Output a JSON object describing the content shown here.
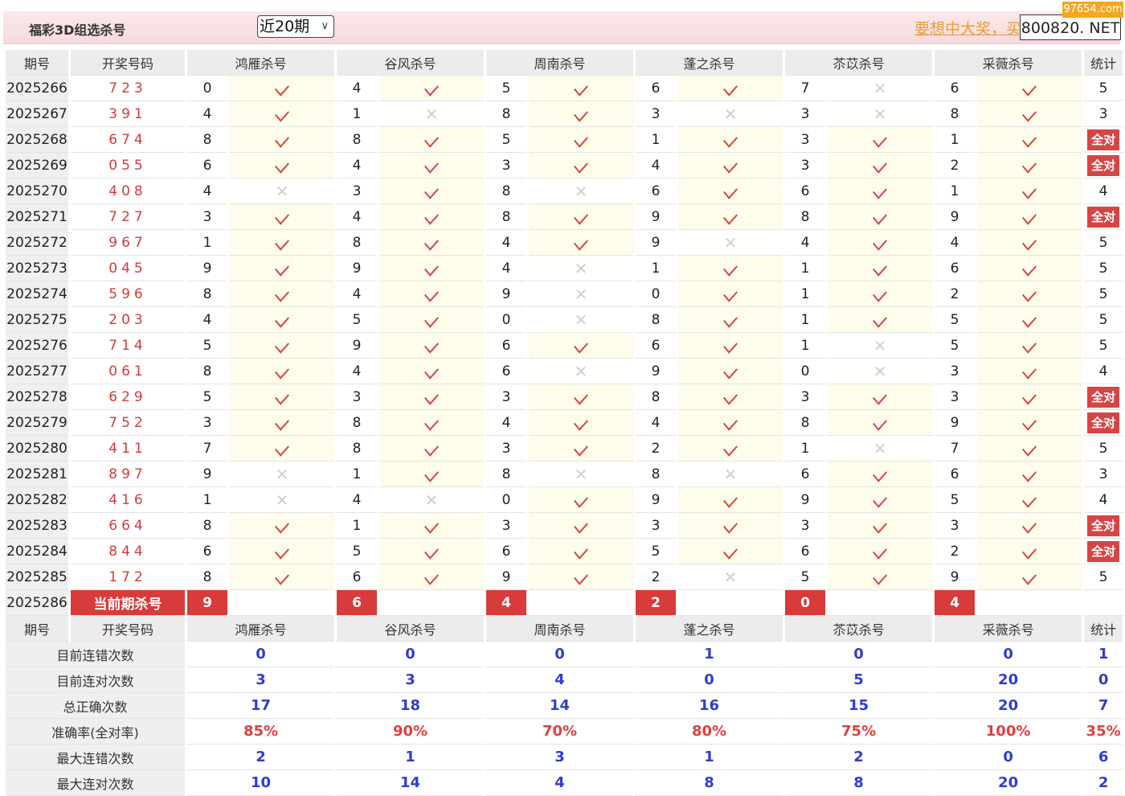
{
  "header": {
    "title": "福彩3D组选杀号",
    "period_select": "近20期",
    "promo_text": "要想中大奖，买",
    "site": "800820. NET",
    "watermark": "97654.com"
  },
  "columns": [
    "期号",
    "开奖号码",
    "鸿雁杀号",
    "谷风杀号",
    "周南杀号",
    "蓬之杀号",
    "苶苡杀号",
    "采薇杀号",
    "统计"
  ],
  "rows": [
    {
      "period": "2025266",
      "draw": "723",
      "kills": [
        [
          "0",
          1
        ],
        [
          "4",
          1
        ],
        [
          "5",
          1
        ],
        [
          "6",
          1
        ],
        [
          "7",
          0
        ],
        [
          "6",
          1
        ]
      ],
      "stat": "5"
    },
    {
      "period": "2025267",
      "draw": "391",
      "kills": [
        [
          "4",
          1
        ],
        [
          "1",
          0
        ],
        [
          "8",
          1
        ],
        [
          "3",
          0
        ],
        [
          "3",
          0
        ],
        [
          "8",
          1
        ]
      ],
      "stat": "3"
    },
    {
      "period": "2025268",
      "draw": "674",
      "kills": [
        [
          "8",
          1
        ],
        [
          "8",
          1
        ],
        [
          "5",
          1
        ],
        [
          "1",
          1
        ],
        [
          "3",
          1
        ],
        [
          "1",
          1
        ]
      ],
      "stat": "全对"
    },
    {
      "period": "2025269",
      "draw": "055",
      "kills": [
        [
          "6",
          1
        ],
        [
          "4",
          1
        ],
        [
          "3",
          1
        ],
        [
          "4",
          1
        ],
        [
          "3",
          1
        ],
        [
          "2",
          1
        ]
      ],
      "stat": "全对"
    },
    {
      "period": "2025270",
      "draw": "408",
      "kills": [
        [
          "4",
          0
        ],
        [
          "3",
          1
        ],
        [
          "8",
          0
        ],
        [
          "6",
          1
        ],
        [
          "6",
          1
        ],
        [
          "1",
          1
        ]
      ],
      "stat": "4"
    },
    {
      "period": "2025271",
      "draw": "727",
      "kills": [
        [
          "3",
          1
        ],
        [
          "4",
          1
        ],
        [
          "8",
          1
        ],
        [
          "9",
          1
        ],
        [
          "8",
          1
        ],
        [
          "9",
          1
        ]
      ],
      "stat": "全对"
    },
    {
      "period": "2025272",
      "draw": "967",
      "kills": [
        [
          "1",
          1
        ],
        [
          "8",
          1
        ],
        [
          "4",
          1
        ],
        [
          "9",
          0
        ],
        [
          "4",
          1
        ],
        [
          "4",
          1
        ]
      ],
      "stat": "5"
    },
    {
      "period": "2025273",
      "draw": "045",
      "kills": [
        [
          "9",
          1
        ],
        [
          "9",
          1
        ],
        [
          "4",
          0
        ],
        [
          "1",
          1
        ],
        [
          "1",
          1
        ],
        [
          "6",
          1
        ]
      ],
      "stat": "5"
    },
    {
      "period": "2025274",
      "draw": "596",
      "kills": [
        [
          "8",
          1
        ],
        [
          "4",
          1
        ],
        [
          "9",
          0
        ],
        [
          "0",
          1
        ],
        [
          "1",
          1
        ],
        [
          "2",
          1
        ]
      ],
      "stat": "5"
    },
    {
      "period": "2025275",
      "draw": "203",
      "kills": [
        [
          "4",
          1
        ],
        [
          "5",
          1
        ],
        [
          "0",
          0
        ],
        [
          "8",
          1
        ],
        [
          "1",
          1
        ],
        [
          "5",
          1
        ]
      ],
      "stat": "5"
    },
    {
      "period": "2025276",
      "draw": "714",
      "kills": [
        [
          "5",
          1
        ],
        [
          "9",
          1
        ],
        [
          "6",
          1
        ],
        [
          "6",
          1
        ],
        [
          "1",
          0
        ],
        [
          "5",
          1
        ]
      ],
      "stat": "5"
    },
    {
      "period": "2025277",
      "draw": "061",
      "kills": [
        [
          "8",
          1
        ],
        [
          "4",
          1
        ],
        [
          "6",
          0
        ],
        [
          "9",
          1
        ],
        [
          "0",
          0
        ],
        [
          "3",
          1
        ]
      ],
      "stat": "4"
    },
    {
      "period": "2025278",
      "draw": "629",
      "kills": [
        [
          "5",
          1
        ],
        [
          "3",
          1
        ],
        [
          "3",
          1
        ],
        [
          "8",
          1
        ],
        [
          "3",
          1
        ],
        [
          "3",
          1
        ]
      ],
      "stat": "全对"
    },
    {
      "period": "2025279",
      "draw": "752",
      "kills": [
        [
          "3",
          1
        ],
        [
          "8",
          1
        ],
        [
          "4",
          1
        ],
        [
          "4",
          1
        ],
        [
          "8",
          1
        ],
        [
          "9",
          1
        ]
      ],
      "stat": "全对"
    },
    {
      "period": "2025280",
      "draw": "411",
      "kills": [
        [
          "7",
          1
        ],
        [
          "8",
          1
        ],
        [
          "3",
          1
        ],
        [
          "2",
          1
        ],
        [
          "1",
          0
        ],
        [
          "7",
          1
        ]
      ],
      "stat": "5"
    },
    {
      "period": "2025281",
      "draw": "897",
      "kills": [
        [
          "9",
          0
        ],
        [
          "1",
          1
        ],
        [
          "8",
          0
        ],
        [
          "8",
          0
        ],
        [
          "6",
          1
        ],
        [
          "6",
          1
        ]
      ],
      "stat": "3"
    },
    {
      "period": "2025282",
      "draw": "416",
      "kills": [
        [
          "1",
          0
        ],
        [
          "4",
          0
        ],
        [
          "0",
          1
        ],
        [
          "9",
          1
        ],
        [
          "9",
          1
        ],
        [
          "5",
          1
        ]
      ],
      "stat": "4"
    },
    {
      "period": "2025283",
      "draw": "664",
      "kills": [
        [
          "8",
          1
        ],
        [
          "1",
          1
        ],
        [
          "3",
          1
        ],
        [
          "3",
          1
        ],
        [
          "3",
          1
        ],
        [
          "3",
          1
        ]
      ],
      "stat": "全对"
    },
    {
      "period": "2025284",
      "draw": "844",
      "kills": [
        [
          "6",
          1
        ],
        [
          "5",
          1
        ],
        [
          "6",
          1
        ],
        [
          "5",
          1
        ],
        [
          "6",
          1
        ],
        [
          "2",
          1
        ]
      ],
      "stat": "全对"
    },
    {
      "period": "2025285",
      "draw": "172",
      "kills": [
        [
          "8",
          1
        ],
        [
          "6",
          1
        ],
        [
          "9",
          1
        ],
        [
          "2",
          0
        ],
        [
          "5",
          1
        ],
        [
          "9",
          1
        ]
      ],
      "stat": "5"
    }
  ],
  "current": {
    "period": "2025286",
    "label": "当前期杀号",
    "kills": [
      "9",
      "6",
      "4",
      "2",
      "0",
      "4"
    ]
  },
  "summary_header": [
    "期号",
    "开奖号码",
    "鸿雁杀号",
    "谷风杀号",
    "周南杀号",
    "蓬之杀号",
    "苶苡杀号",
    "采薇杀号",
    "统计"
  ],
  "summary": [
    {
      "label": "目前连错次数",
      "values": [
        "0",
        "0",
        "0",
        "1",
        "0",
        "0",
        "1"
      ],
      "red": false
    },
    {
      "label": "目前连对次数",
      "values": [
        "3",
        "3",
        "4",
        "0",
        "5",
        "20",
        "0"
      ],
      "red": false
    },
    {
      "label": "总正确次数",
      "values": [
        "17",
        "18",
        "14",
        "16",
        "15",
        "20",
        "7"
      ],
      "red": false
    },
    {
      "label": "准确率(全对率)",
      "values": [
        "85%",
        "90%",
        "70%",
        "80%",
        "75%",
        "100%",
        "35%"
      ],
      "red": true
    },
    {
      "label": "最大连错次数",
      "values": [
        "2",
        "1",
        "3",
        "1",
        "2",
        "0",
        "6"
      ],
      "red": false
    },
    {
      "label": "最大连对次数",
      "values": [
        "10",
        "14",
        "4",
        "8",
        "8",
        "20",
        "2"
      ],
      "red": false
    }
  ],
  "colors": {
    "accent": "#d64545",
    "summary_value": "#2f3ed0",
    "draw_text": "#d23b3b"
  }
}
